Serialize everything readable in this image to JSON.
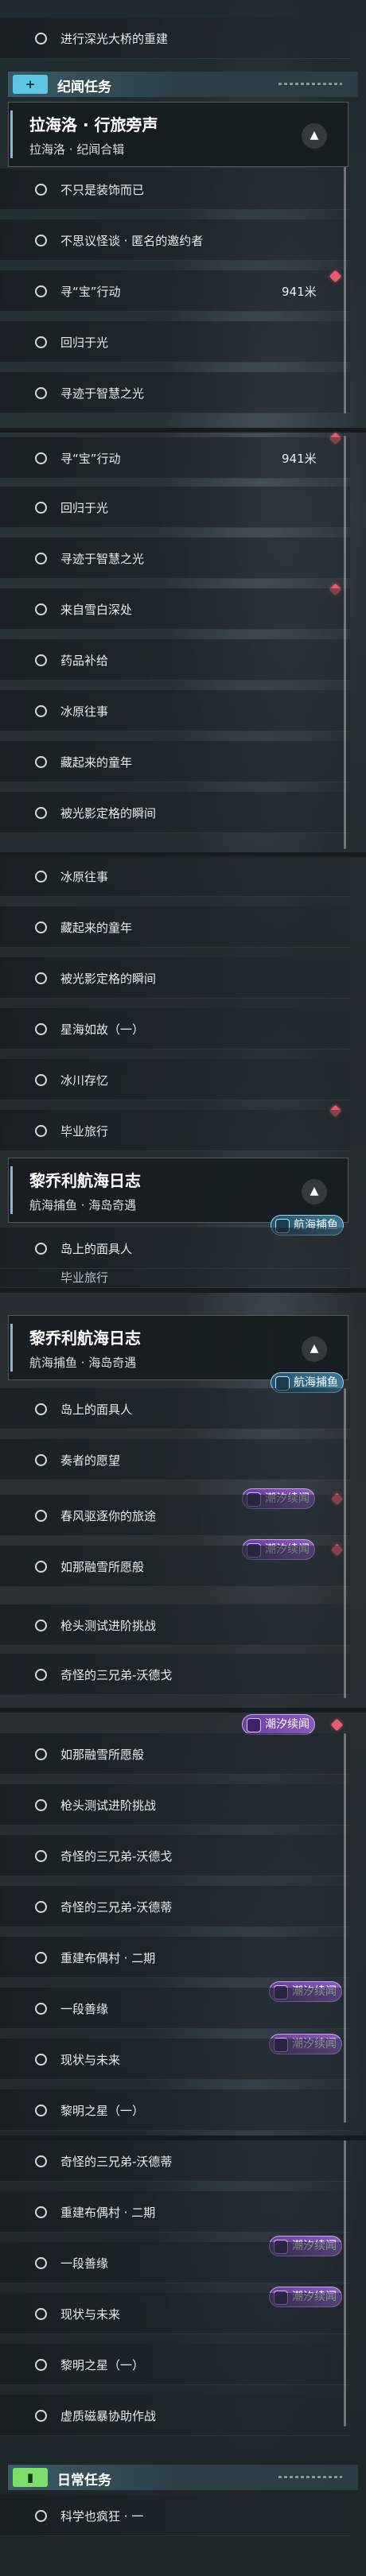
{
  "sections": {
    "jiwen": "纪闻任务",
    "daily": "日常任务",
    "jiwen_icon": "plus-icon",
    "daily_icon": "book-icon"
  },
  "groups": {
    "lahailuo": {
      "title": "拉海洛 · 行旅旁声",
      "subtitle": "拉海洛 · 纪闻合辑"
    },
    "liqiaoli": {
      "title": "黎乔利航海日志",
      "subtitle": "航海捕鱼 · 海岛奇遇"
    }
  },
  "tags": {
    "fishing": "航海捕鱼",
    "tide": "潮汐续闻"
  },
  "quests": {
    "q0": "进行深光大桥的重建",
    "q1": "不只是装饰而已",
    "q2": "不思议怪谈 · 匿名的邀约者",
    "q3": "寻“宝”行动",
    "q4": "回归于光",
    "q5": "寻迹于智慧之光",
    "q6": "来自雪白深处",
    "q7": "药品补给",
    "q8": "冰原往事",
    "q9": "藏起来的童年",
    "q10": "被光影定格的瞬间",
    "q11": "星海如故（一）",
    "q12": "冰川存忆",
    "q13": "毕业旅行",
    "q14": "岛上的面具人",
    "q15": "奏者的愿望",
    "q16": "春风驱逐你的旅途",
    "q17": "如那融雪所愿般",
    "q18": "枪头测试进阶挑战",
    "q19": "奇怪的三兄弟-沃德戈",
    "q20": "奇怪的三兄弟-沃德蒂",
    "q21": "重建布偶村 · 二期",
    "q22": "一段善缘",
    "q23": "现状与未来",
    "q24": "黎明之星（一）",
    "q25": "虚质磁暴协助作战",
    "q26": "科学也疯狂 · 一",
    "q27": "毕业旅行"
  },
  "distance": "941米",
  "colors": {
    "accent": "#5ec6e0",
    "tide_purple": "#8a5ac0",
    "fishing_blue": "#3a7894",
    "gem_red": "#e85a72"
  }
}
